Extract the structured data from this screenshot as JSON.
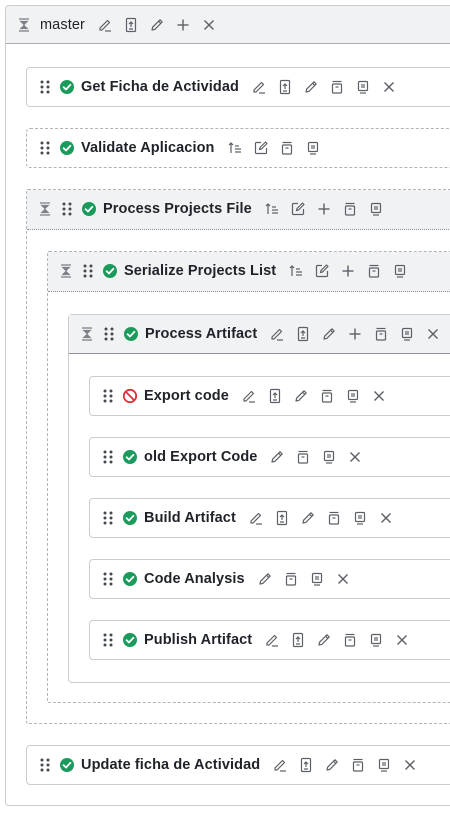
{
  "master": {
    "title": "master",
    "icons": [
      "collapse-icon",
      "edit-icon",
      "document-icon",
      "pencil-icon",
      "plus-icon",
      "close-icon"
    ]
  },
  "steps": {
    "get_ficha": {
      "title": "Get Ficha de Actividad",
      "status": "success"
    },
    "validate": {
      "title": "Validate Aplicacion",
      "status": "success"
    },
    "process_projects": {
      "title": "Process Projects File",
      "status": "success"
    },
    "serialize": {
      "title": "Serialize Projects List",
      "status": "success"
    },
    "process_artifact": {
      "title": "Process Artifact",
      "status": "success"
    },
    "export_code": {
      "title": "Export code",
      "status": "disabled"
    },
    "old_export": {
      "title": "old Export Code",
      "status": "success"
    },
    "build": {
      "title": "Build Artifact",
      "status": "success"
    },
    "analysis": {
      "title": "Code Analysis",
      "status": "success"
    },
    "publish": {
      "title": "Publish Artifact",
      "status": "success"
    },
    "update_ficha": {
      "title": "Update ficha de Actividad",
      "status": "success"
    }
  },
  "colors": {
    "success": "#1a9b5b",
    "disabled": "#e0313a",
    "border": "#c9ccd1",
    "header_bg": "#f1f2f4"
  }
}
